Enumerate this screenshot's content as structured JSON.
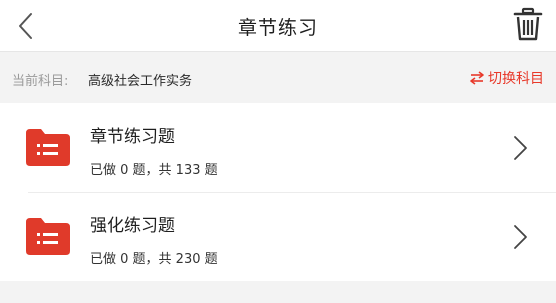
{
  "header": {
    "title": "章节练习"
  },
  "subject": {
    "label": "当前科目:",
    "name": "高级社会工作实务",
    "switch_label": "切换科目"
  },
  "items": [
    {
      "title": "章节练习题",
      "summary": "已做 0 题，共 133 题"
    },
    {
      "title": "强化练习题",
      "summary": "已做 0 题，共 230 题"
    }
  ],
  "colors": {
    "accent": "#e8392a",
    "folder": "#e03a2a"
  },
  "icons": {
    "back": "chevron-left-icon",
    "trash": "trash-icon",
    "switch": "swap-arrows-icon",
    "folder": "folder-list-icon",
    "chevron": "chevron-right-icon"
  }
}
